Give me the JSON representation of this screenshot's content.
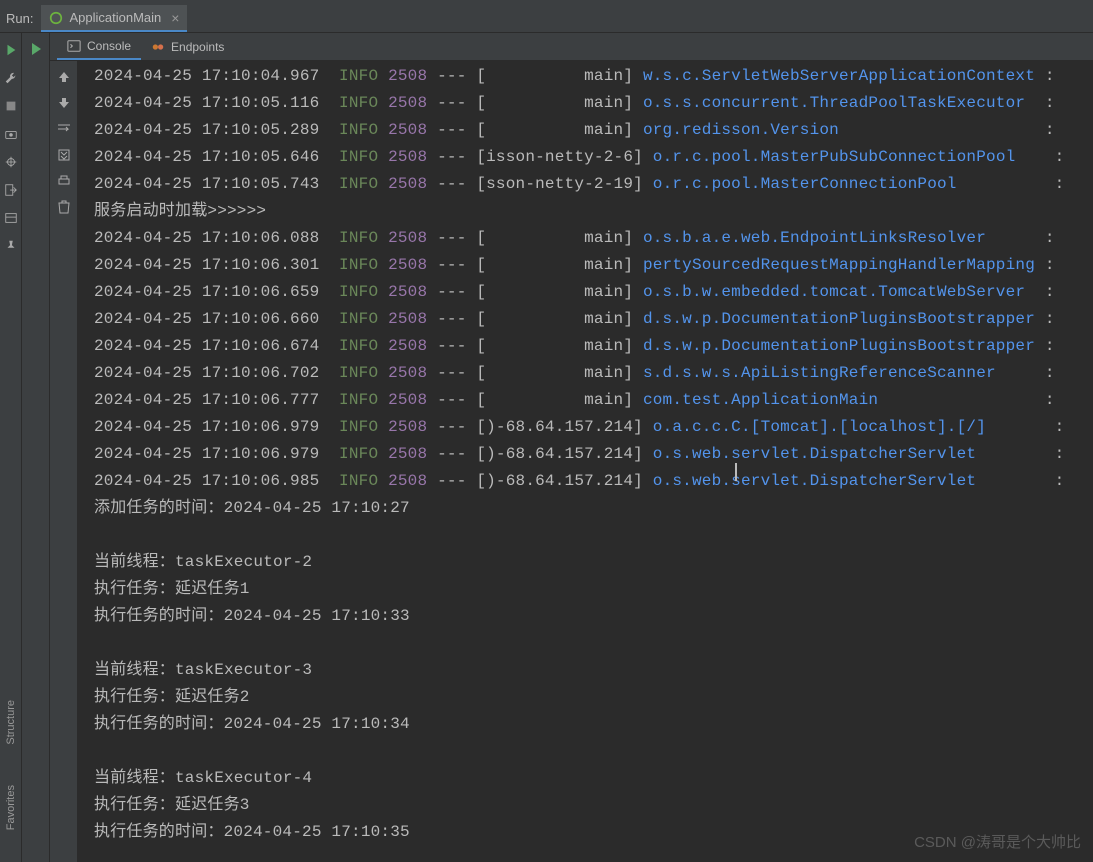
{
  "header": {
    "run_label": "Run:",
    "tab_name": "ApplicationMain"
  },
  "sub_tabs": {
    "console": "Console",
    "endpoints": "Endpoints"
  },
  "sidebar": {
    "structure": "Structure",
    "favorites": "Favorites"
  },
  "watermark": "CSDN @涛哥是个大帅比",
  "colors": {
    "info": "#6a8759",
    "pid": "#9876aa",
    "logger": "#5394ec"
  },
  "process_id": "2508",
  "log_rows": [
    {
      "ts": "2024-04-25 17:10:04.967",
      "thread": "          main",
      "logger": "w.s.c.ServletWebServerApplicationContext"
    },
    {
      "ts": "2024-04-25 17:10:05.116",
      "thread": "          main",
      "logger": "o.s.s.concurrent.ThreadPoolTaskExecutor"
    },
    {
      "ts": "2024-04-25 17:10:05.289",
      "thread": "          main",
      "logger": "org.redisson.Version"
    },
    {
      "ts": "2024-04-25 17:10:05.646",
      "thread": "isson-netty-2-6",
      "logger": "o.r.c.pool.MasterPubSubConnectionPool"
    },
    {
      "ts": "2024-04-25 17:10:05.743",
      "thread": "sson-netty-2-19",
      "logger": "o.r.c.pool.MasterConnectionPool"
    }
  ],
  "mid_text": "服务启动时加载>>>>>>",
  "log_rows2": [
    {
      "ts": "2024-04-25 17:10:06.088",
      "thread": "          main",
      "logger": "o.s.b.a.e.web.EndpointLinksResolver"
    },
    {
      "ts": "2024-04-25 17:10:06.301",
      "thread": "          main",
      "logger": "pertySourcedRequestMappingHandlerMapping"
    },
    {
      "ts": "2024-04-25 17:10:06.659",
      "thread": "          main",
      "logger": "o.s.b.w.embedded.tomcat.TomcatWebServer"
    },
    {
      "ts": "2024-04-25 17:10:06.660",
      "thread": "          main",
      "logger": "d.s.w.p.DocumentationPluginsBootstrapper"
    },
    {
      "ts": "2024-04-25 17:10:06.674",
      "thread": "          main",
      "logger": "d.s.w.p.DocumentationPluginsBootstrapper"
    },
    {
      "ts": "2024-04-25 17:10:06.702",
      "thread": "          main",
      "logger": "s.d.s.w.s.ApiListingReferenceScanner"
    },
    {
      "ts": "2024-04-25 17:10:06.777",
      "thread": "          main",
      "logger": "com.test.ApplicationMain"
    },
    {
      "ts": "2024-04-25 17:10:06.979",
      "thread": ")-68.64.157.214",
      "logger": "o.a.c.c.C.[Tomcat].[localhost].[/]"
    },
    {
      "ts": "2024-04-25 17:10:06.979",
      "thread": ")-68.64.157.214",
      "logger": "o.s.web.servlet.DispatcherServlet"
    },
    {
      "ts": "2024-04-25 17:10:06.985",
      "thread": ")-68.64.157.214",
      "logger": "o.s.web.servlet.DispatcherServlet"
    }
  ],
  "tail_lines": [
    "添加任务的时间：2024-04-25 17:10:27",
    "",
    "当前线程：taskExecutor-2",
    "执行任务：延迟任务1",
    "执行任务的时间：2024-04-25 17:10:33",
    "",
    "当前线程：taskExecutor-3",
    "执行任务：延迟任务2",
    "执行任务的时间：2024-04-25 17:10:34",
    "",
    "当前线程：taskExecutor-4",
    "执行任务：延迟任务3",
    "执行任务的时间：2024-04-25 17:10:35"
  ],
  "level": "INFO",
  "dash": " --- "
}
